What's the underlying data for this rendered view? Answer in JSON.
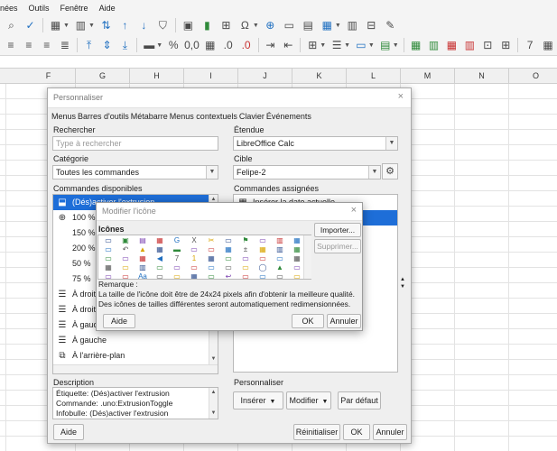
{
  "menubar": [
    "nées",
    "Outils",
    "Fenêtre",
    "Aide"
  ],
  "columns": [
    "F",
    "G",
    "H",
    "I",
    "J",
    "K",
    "L",
    "M",
    "N",
    "O"
  ],
  "dialog": {
    "title": "Personnaliser",
    "close": "×",
    "tabs": [
      "Menus",
      "Barres d'outils",
      "Métabarre",
      "Menus contextuels",
      "Clavier",
      "Événements"
    ],
    "search": {
      "label": "Rechercher",
      "placeholder": "Type à rechercher"
    },
    "scope": {
      "label": "Étendue",
      "value": "LibreOffice Calc"
    },
    "category": {
      "label": "Catégorie",
      "value": "Toutes les commandes"
    },
    "target": {
      "label": "Cible",
      "value": "Felipe-2"
    },
    "available": {
      "label": "Commandes disponibles",
      "items": [
        {
          "label": "(Dés)activer l'extrusion",
          "icon": "extrusion-icon",
          "selected": true
        },
        {
          "label": "100 %",
          "icon": "zoom-100-icon"
        },
        {
          "label": "150 %",
          "icon": ""
        },
        {
          "label": "200 %",
          "icon": ""
        },
        {
          "label": "50 %",
          "icon": ""
        },
        {
          "label": "75 %",
          "icon": ""
        },
        {
          "label": "À droite",
          "icon": "align-right-icon"
        },
        {
          "label": "À droite",
          "icon": "align-right-icon"
        },
        {
          "label": "À gauche",
          "icon": "align-left-icon"
        },
        {
          "label": "À gauche",
          "icon": "align-left-icon"
        },
        {
          "label": "À l'arrière-plan",
          "icon": "send-to-back-icon"
        }
      ]
    },
    "assigned": {
      "label": "Commandes assignées",
      "items": [
        {
          "label": "Insérer la date actuelle",
          "icon": "date-icon",
          "selected": false
        },
        {
          "label": "",
          "icon": "",
          "selected": true
        }
      ]
    },
    "description": {
      "label": "Description",
      "lines": [
        "Étiquette: (Dés)activer l'extrusion",
        "Commande: .uno:ExtrusionToggle",
        "Infobulle: (Dés)activer l'extrusion"
      ]
    },
    "customize": {
      "label": "Personnaliser",
      "insert": "Insérer",
      "modify": "Modifier",
      "default": "Par défaut"
    },
    "buttons": {
      "help": "Aide",
      "reset": "Réinitialiser",
      "ok": "OK",
      "cancel": "Annuler"
    }
  },
  "icon_dialog": {
    "title": "Modifier l'icône",
    "close": "×",
    "icons_label": "Icônes",
    "import": "Importer...",
    "delete": "Supprimer...",
    "note_label": "Remarque :",
    "note_text": "La taille de l'icône doit être de 24x24 pixels afin d'obtenir la meilleure qualité. Des icônes de tailles différentes seront automatiquement redimensionnées.",
    "help": "Aide",
    "ok": "OK",
    "cancel": "Annuler"
  }
}
